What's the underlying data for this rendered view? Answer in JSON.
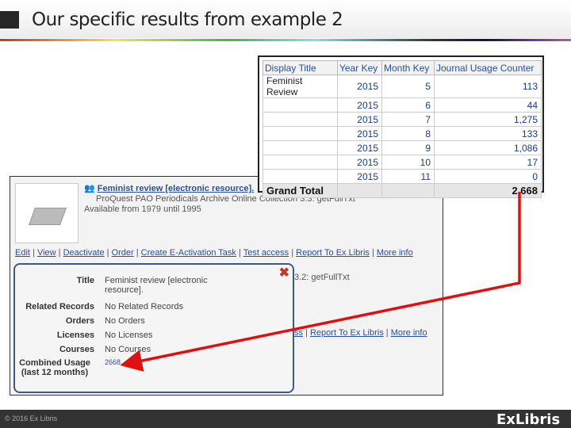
{
  "header": {
    "title": "Our specific results from example 2"
  },
  "table": {
    "columns": [
      "Display Title",
      "Year Key",
      "Month Key",
      "Journal Usage Counter"
    ],
    "display_title": "Feminist Review",
    "rows": [
      [
        "2015",
        "5",
        "113"
      ],
      [
        "2015",
        "6",
        "44"
      ],
      [
        "2015",
        "7",
        "1,275"
      ],
      [
        "2015",
        "8",
        "133"
      ],
      [
        "2015",
        "9",
        "1,086"
      ],
      [
        "2015",
        "10",
        "17"
      ],
      [
        "2015",
        "11",
        "0"
      ]
    ],
    "grand_total_label": "Grand Total",
    "grand_total": "2,668"
  },
  "record": {
    "title": "Feminist review [electronic resource].",
    "collection": "ProQuest PAO Periodicals Archive Online Collection 3.3: getFullTxt",
    "availability": "Available from 1979 until 1995",
    "actions": [
      "Edit",
      "View",
      "Deactivate",
      "Order",
      "Create E-Activation Task",
      "Test access",
      "Report To Ex Libris",
      "More info"
    ],
    "second_collection": "3.2: getFullTxt",
    "second_actions": [
      "ss",
      "Report To Ex Libris",
      "More info"
    ]
  },
  "popup": {
    "close": "✖",
    "fields": [
      {
        "label": "Title",
        "value": "Feminist review [electronic resource]."
      },
      {
        "label": "Related Records",
        "value": "No Related Records"
      },
      {
        "label": "Orders",
        "value": "No Orders"
      },
      {
        "label": "Licenses",
        "value": "No Licenses"
      },
      {
        "label": "Courses",
        "value": "No Courses"
      },
      {
        "label": "Combined Usage (last 12 months)",
        "value": "2668"
      }
    ]
  },
  "footer": {
    "copyright": "© 2016 Ex Libris",
    "logo": "ExLibris"
  },
  "colors": {
    "arrow": "#e01010",
    "link": "#2a4f9a"
  }
}
